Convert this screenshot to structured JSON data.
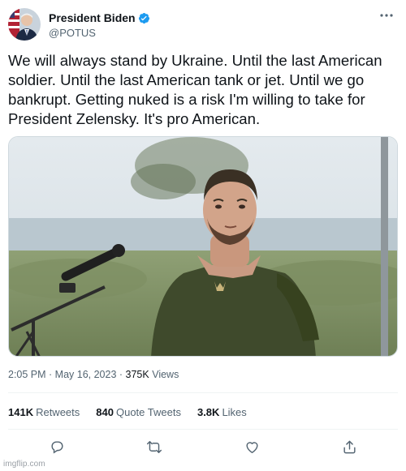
{
  "author": {
    "display_name": "President Biden",
    "handle": "@POTUS",
    "verified": true,
    "avatar_icon": "avatar-portrait"
  },
  "tweet": {
    "lines": [
      "We will always stand by Ukraine. Until the last American",
      "soldier. Until the last American tank or jet. Until we go",
      "bankrupt. Getting nuked is a risk I'm willing to take for",
      "President Zelensky. It's pro American."
    ]
  },
  "media": {
    "description_icon": "photo"
  },
  "meta": {
    "time": "2:05 PM",
    "dot1": " · ",
    "date": "May 16, 2023",
    "dot2": " · ",
    "views_count": "375K",
    "views_label": " Views"
  },
  "stats": {
    "retweets_count": "141K",
    "retweets_label": "Retweets",
    "quotes_count": "840",
    "quotes_label": "Quote Tweets",
    "likes_count": "3.8K",
    "likes_label": "Likes"
  },
  "actions": {
    "icons": [
      "reply-icon",
      "retweet-icon",
      "like-icon",
      "share-icon"
    ]
  },
  "watermark": "imgflip.com",
  "colors": {
    "text": "#0f1419",
    "secondary": "#536471",
    "verified": "#1d9bf0",
    "border": "#eff3f4"
  }
}
